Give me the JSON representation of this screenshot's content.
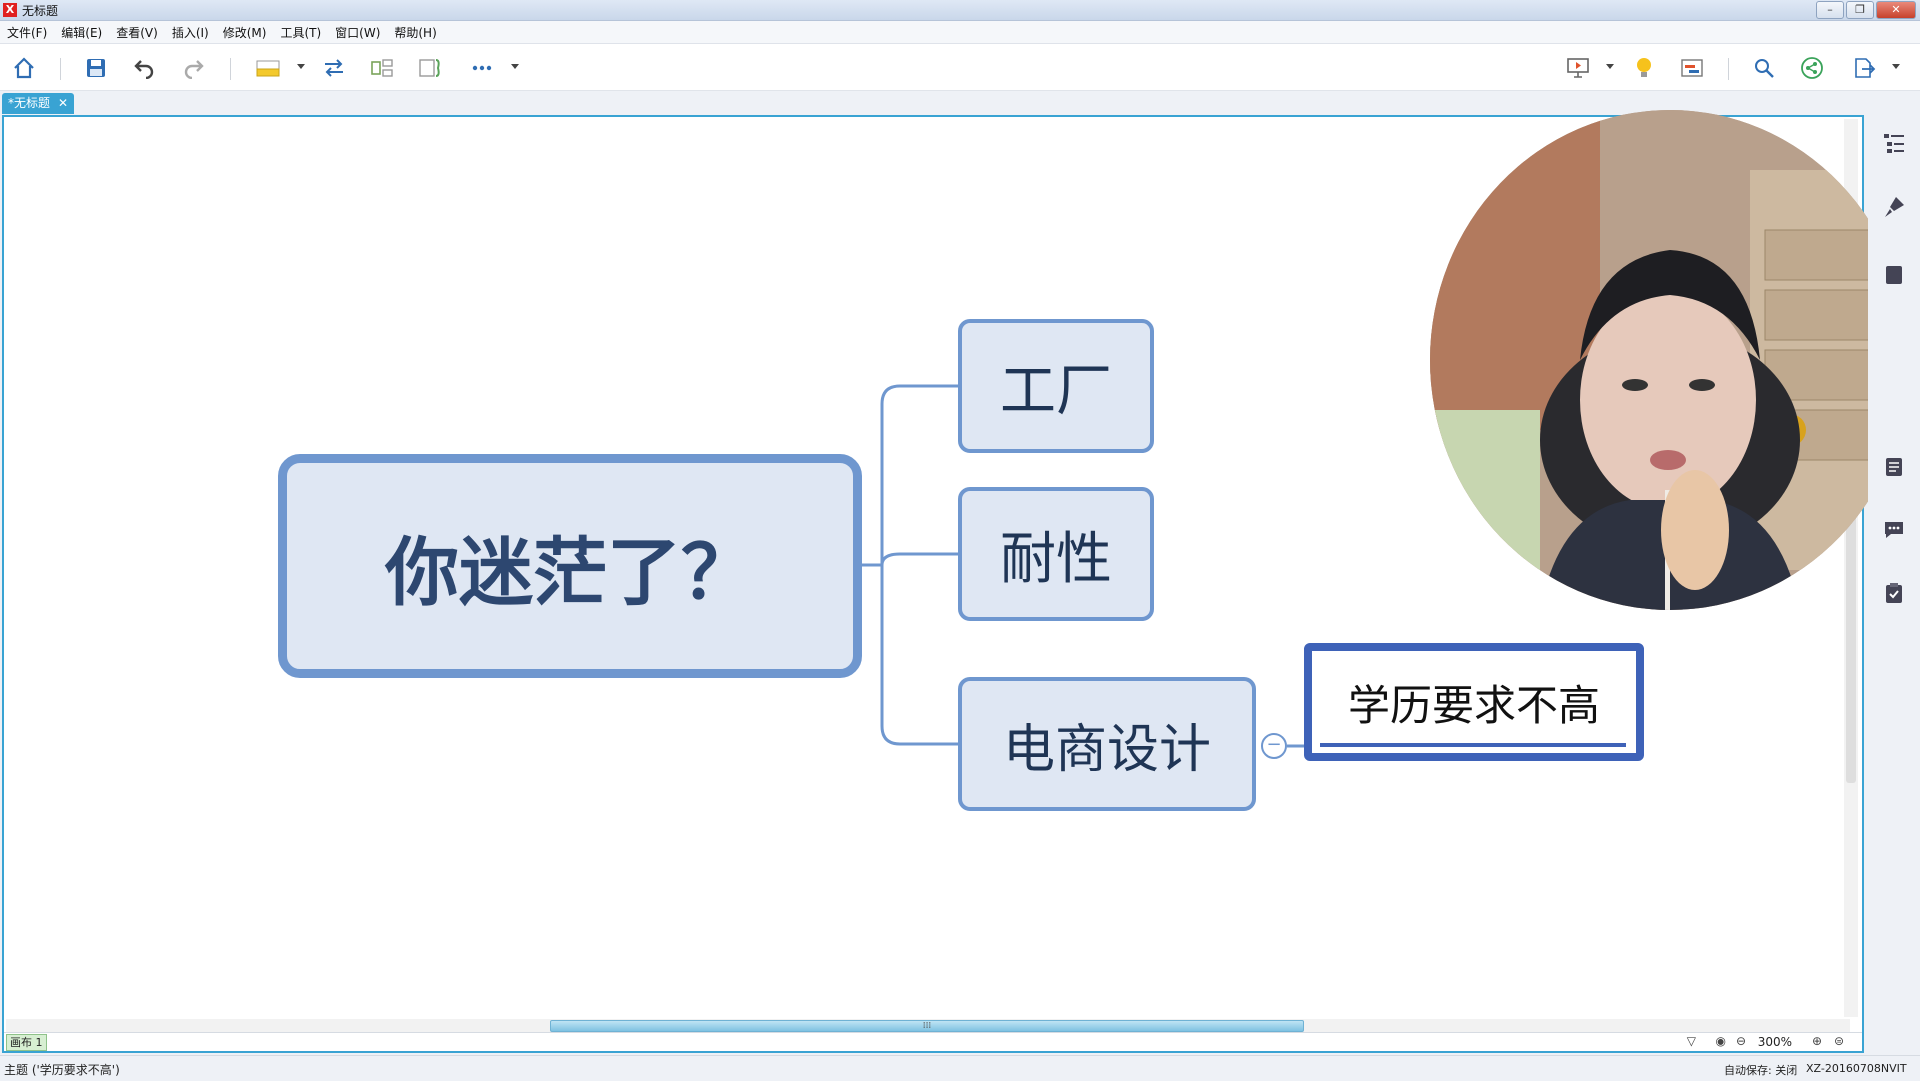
{
  "window": {
    "title": "无标题"
  },
  "menu": [
    "文件(F)",
    "编辑(E)",
    "查看(V)",
    "插入(I)",
    "修改(M)",
    "工具(T)",
    "窗口(W)",
    "帮助(H)"
  ],
  "tab": {
    "label": "*无标题",
    "close": "✕"
  },
  "map": {
    "central": "你迷茫了？",
    "topics": [
      "工厂",
      "耐性",
      "电商设计"
    ],
    "subtopic": "学历要求不高",
    "collapse_symbol": "−"
  },
  "canvas_footer": {
    "sheet": "画布 1",
    "zoom": "300%"
  },
  "status": {
    "selection": "主题 ('学历要求不高')",
    "autosave": "自动保存: 关闭",
    "machine": "XZ-20160708NVIT"
  },
  "colors": {
    "accent": "#39a3d3",
    "node_border": "#6f97cf",
    "node_fill": "#dfe7f3",
    "selected_border": "#3e62b8"
  }
}
